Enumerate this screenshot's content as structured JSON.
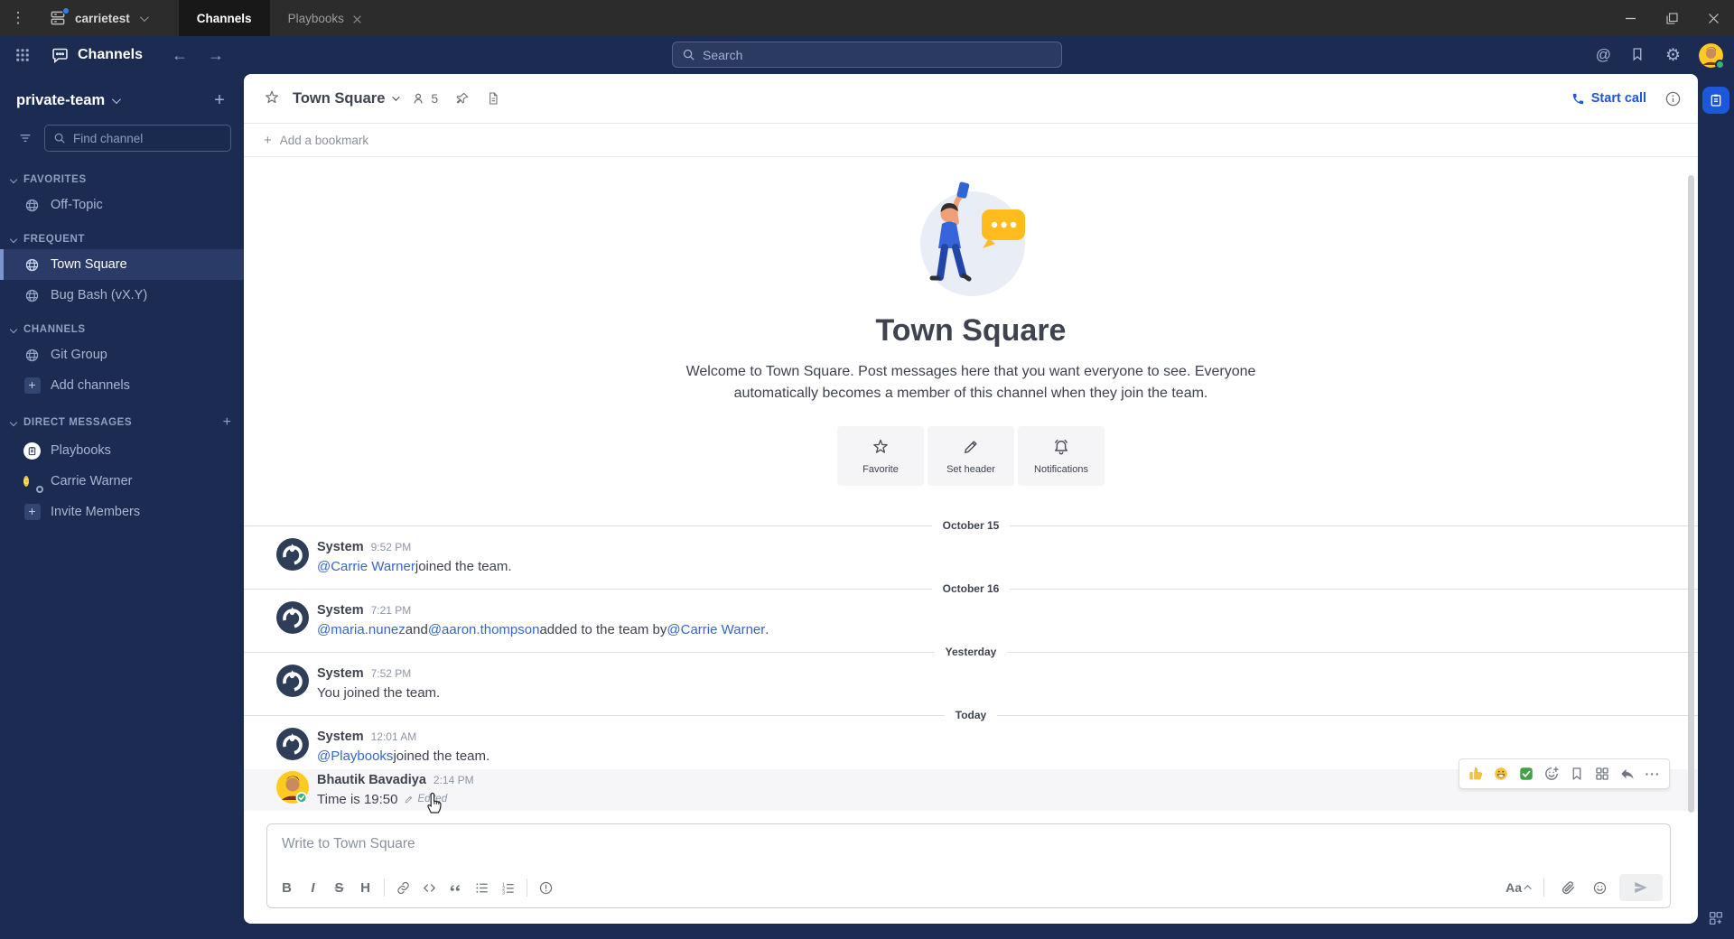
{
  "titlebar": {
    "team_switcher": {
      "label": "carrietest"
    },
    "tabs": [
      {
        "label": "Channels",
        "active": true,
        "closable": false
      },
      {
        "label": "Playbooks",
        "active": false,
        "closable": true
      }
    ]
  },
  "global_header": {
    "product_name": "Channels",
    "search": {
      "placeholder": "Search"
    }
  },
  "sidebar": {
    "team_name": "private-team",
    "find_channel_placeholder": "Find channel",
    "sections": [
      {
        "label": "FAVORITES",
        "add_button": false,
        "items": [
          {
            "label": "Off-Topic",
            "icon": "globe",
            "active": false
          }
        ]
      },
      {
        "label": "FREQUENT",
        "add_button": false,
        "items": [
          {
            "label": "Town Square",
            "icon": "globe",
            "active": true
          },
          {
            "label": "Bug Bash (vX.Y)",
            "icon": "globe",
            "active": false
          }
        ]
      },
      {
        "label": "CHANNELS",
        "add_button": false,
        "items": [
          {
            "label": "Git Group",
            "icon": "globe",
            "active": false
          },
          {
            "label": "Add channels",
            "icon": "plus",
            "active": false
          }
        ]
      },
      {
        "label": "DIRECT MESSAGES",
        "add_button": true,
        "items": [
          {
            "label": "Playbooks",
            "icon": "playbooks",
            "active": false
          },
          {
            "label": "Carrie Warner",
            "icon": "carrie",
            "active": false
          },
          {
            "label": "Invite Members",
            "icon": "plus",
            "active": false
          }
        ]
      }
    ]
  },
  "channel_header": {
    "name": "Town Square",
    "member_count": "5",
    "start_call_label": "Start call"
  },
  "bookmark_bar": {
    "add_label": "Add a bookmark"
  },
  "intro": {
    "title": "Town Square",
    "description": "Welcome to Town Square. Post messages here that you want everyone to see. Everyone automatically becomes a member of this channel when they join the team.",
    "actions": [
      {
        "label": "Favorite",
        "icon": "star"
      },
      {
        "label": "Set header",
        "icon": "pencil"
      },
      {
        "label": "Notifications",
        "icon": "bell"
      }
    ]
  },
  "feed": [
    {
      "type": "divider",
      "label": "October 15"
    },
    {
      "type": "message",
      "author": "System",
      "time": "9:52 PM",
      "avatar": "system",
      "segments": [
        {
          "text": "@Carrie Warner",
          "link": true
        },
        {
          "text": " joined the team.",
          "link": false
        }
      ]
    },
    {
      "type": "divider",
      "label": "October 16"
    },
    {
      "type": "message",
      "author": "System",
      "time": "7:21 PM",
      "avatar": "system",
      "segments": [
        {
          "text": "@maria.nunez",
          "link": true
        },
        {
          "text": " and ",
          "link": false
        },
        {
          "text": "@aaron.thompson",
          "link": true
        },
        {
          "text": " added to the team by ",
          "link": false
        },
        {
          "text": "@Carrie Warner",
          "link": true
        },
        {
          "text": ".",
          "link": false
        }
      ]
    },
    {
      "type": "divider",
      "label": "Yesterday"
    },
    {
      "type": "message",
      "author": "System",
      "time": "7:52 PM",
      "avatar": "system",
      "segments": [
        {
          "text": "You joined the team.",
          "link": false
        }
      ]
    },
    {
      "type": "divider",
      "label": "Today"
    },
    {
      "type": "message",
      "author": "System",
      "time": "12:01 AM",
      "avatar": "system",
      "segments": [
        {
          "text": "@Playbooks",
          "link": true
        },
        {
          "text": " joined the team.",
          "link": false
        }
      ]
    },
    {
      "type": "message",
      "author": "Bhautik Bavadiya",
      "time": "2:14 PM",
      "avatar": "bhautik",
      "hovered": true,
      "segments": [
        {
          "text": "Time is 19:50",
          "link": false
        }
      ],
      "edited_label": "Edited",
      "show_cursor": true,
      "hover_toolbar": {
        "reactions": [
          "thumbs-up",
          "grinning-face",
          "check-mark-button"
        ],
        "buttons": [
          "add-reaction",
          "save-message",
          "message-apps",
          "reply",
          "more-actions"
        ]
      }
    }
  ],
  "composer": {
    "placeholder": "Write to Town Square",
    "format": {
      "bold": "B",
      "italic": "I",
      "strike": "S",
      "heading": "H"
    },
    "aa_label": "Aa"
  },
  "colors": {
    "navy": "#1c2b51",
    "accent_blue": "#1c58d9",
    "link_blue": "#3866c8",
    "active_channel_bar": "#7a95cf"
  }
}
